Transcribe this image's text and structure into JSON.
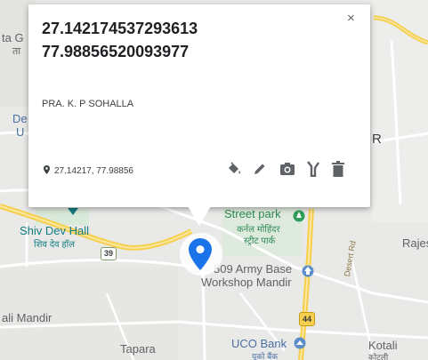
{
  "popup": {
    "coord_line1": "27.142174537293613",
    "coord_line2": "77.98856520093977",
    "place_name": "PRA. K. P SOHALLA",
    "latlng_short": "27.14217, 77.98856",
    "close_glyph": "×",
    "tools": [
      {
        "icon": "paint-bucket-icon"
      },
      {
        "icon": "pencil-icon"
      },
      {
        "icon": "camera-icon"
      },
      {
        "icon": "directions-icon"
      },
      {
        "icon": "trash-icon"
      }
    ]
  },
  "map": {
    "labels": {
      "top_left_1": "ta G",
      "top_left_2": "ता",
      "left_mid_1": "De",
      "left_mid_2": "U",
      "right_mid": "R",
      "shiv_dev_hall": "Shiv Dev Hall",
      "shiv_dev_hall_hi": "शिव देव हॉल",
      "street_park": "Street park",
      "street_park_hi_1": "कर्नल मोहिंदर",
      "street_park_hi_2": "स्ट्रीट पार्क",
      "army_base_1": "509 Army Base",
      "army_base_2": "Workshop Mandir",
      "rajes": "Rajes",
      "ali_mandir": "ali Mandir",
      "tapara": "Tapara",
      "uco_bank": "UCO Bank",
      "uco_bank_hi": "यूको बैंक",
      "kotali": "Kotali",
      "kotali_hi": "कोटली",
      "road_name": "Desert Rd"
    },
    "shields": {
      "route_39": "39",
      "route_44": "44"
    }
  },
  "colors": {
    "map_bg": "#e9e9e7",
    "road_yellow": "#f6cf4d",
    "marker_blue": "#1a73e8",
    "poi_green": "#2e8b57",
    "poi_blue": "#4a6fa5"
  }
}
